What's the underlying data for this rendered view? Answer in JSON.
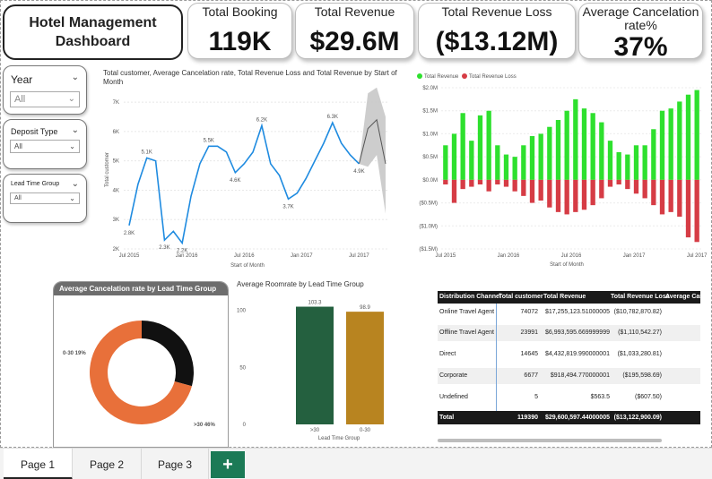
{
  "title": {
    "line1": "Hotel Management",
    "line2": "Dashboard"
  },
  "kpis": [
    {
      "label": "Total Booking",
      "value": "119K"
    },
    {
      "label": "Total Revenue",
      "value": "$29.6M"
    },
    {
      "label": "Total Revenue Loss",
      "value": "($13.12M)"
    },
    {
      "label": "Average Cancelation rate%",
      "value": "37%"
    }
  ],
  "slicers": {
    "year": {
      "title": "Year",
      "value": "All"
    },
    "deposit": {
      "title": "Deposit Type",
      "value": "All"
    },
    "lead": {
      "title": "Lead Time Group",
      "value": "All"
    }
  },
  "tabs": {
    "page1": "Page 1",
    "page2": "Page 2",
    "page3": "Page 3",
    "add": "+"
  },
  "colors": {
    "line": "#1f8be0",
    "revenue": "#2ee02e",
    "loss": "#d63c45",
    "donut_black": "#111111",
    "donut_orange": "#e8703a",
    "bar_green": "#24603f",
    "bar_gold": "#b88420",
    "add_tab": "#1b7a56"
  },
  "chart_data": [
    {
      "type": "line",
      "title": "Total customer, Average Cancelation rate, Total Revenue Loss and Total Revenue by Start of Month",
      "xlabel": "Start of Month",
      "ylabel": "Total customer",
      "x_ticks": [
        "Jul 2015",
        "Jan 2016",
        "Jul 2016",
        "Jan 2017",
        "Jul 2017"
      ],
      "y_ticks": [
        "2K",
        "3K",
        "4K",
        "5K",
        "6K",
        "7K"
      ],
      "ylim": [
        2000,
        7400
      ],
      "values": [
        2800,
        4200,
        5100,
        5000,
        2300,
        2600,
        2200,
        3800,
        4900,
        5500,
        5500,
        5300,
        4600,
        4900,
        5300,
        6200,
        4900,
        4500,
        3700,
        3900,
        4400,
        5000,
        5600,
        6300,
        5600,
        5200,
        4900
      ],
      "data_labels": [
        {
          "index": 0,
          "text": "2.8K"
        },
        {
          "index": 2,
          "text": "5.1K"
        },
        {
          "index": 4,
          "text": "2.3K"
        },
        {
          "index": 6,
          "text": "2.2K"
        },
        {
          "index": 9,
          "text": "5.5K"
        },
        {
          "index": 12,
          "text": "4.6K"
        },
        {
          "index": 15,
          "text": "6.2K"
        },
        {
          "index": 18,
          "text": "3.7K"
        },
        {
          "index": 23,
          "text": "6.3K"
        },
        {
          "index": 26,
          "text": "4.9K"
        }
      ],
      "forecast": {
        "values": [
          4900,
          6100,
          6400,
          4900
        ],
        "upper": [
          4900,
          7300,
          7500,
          6500
        ],
        "lower": [
          4900,
          4800,
          5200,
          3200
        ]
      }
    },
    {
      "type": "bar",
      "series": [
        {
          "name": "Total Revenue",
          "values": [
            0.75,
            1.0,
            1.45,
            0.85,
            1.4,
            1.5,
            0.75,
            0.55,
            0.5,
            0.75,
            0.95,
            1.0,
            1.15,
            1.3,
            1.5,
            1.75,
            1.55,
            1.45,
            1.25,
            0.85,
            0.6,
            0.55,
            0.75,
            0.75,
            1.1,
            1.5,
            1.55,
            1.7,
            1.85,
            1.95
          ]
        },
        {
          "name": "Total Revenue Loss",
          "values": [
            -0.1,
            -0.5,
            -0.2,
            -0.15,
            -0.1,
            -0.25,
            -0.1,
            -0.15,
            -0.25,
            -0.35,
            -0.5,
            -0.45,
            -0.6,
            -0.7,
            -0.75,
            -0.7,
            -0.65,
            -0.55,
            -0.4,
            -0.15,
            -0.1,
            -0.2,
            -0.3,
            -0.4,
            -0.55,
            -0.75,
            -0.7,
            -0.8,
            -1.25,
            -1.35
          ]
        }
      ],
      "xlabel": "Start of Month",
      "x_ticks": [
        "Jul 2015",
        "Jan 2016",
        "Jul 2016",
        "Jan 2017",
        "Jul 2017"
      ],
      "y_ticks": [
        "$2.0M",
        "$1.5M",
        "$1.0M",
        "$0.5M",
        "$0.0M",
        "($0.5M)",
        "($1.0M)",
        "($1.5M)"
      ],
      "ylim": [
        -1.5,
        2.0
      ]
    },
    {
      "type": "pie",
      "title": "Average Cancelation rate by Lead Time Group",
      "slices": [
        {
          "label": "0-30 19%",
          "value": 19
        },
        {
          "label": ">30 46%",
          "value": 46
        }
      ]
    },
    {
      "type": "bar",
      "title": "Average Roomrate by Lead Time Group",
      "xlabel": "Lead Time Group",
      "categories": [
        ">30",
        "0-30"
      ],
      "values": [
        103.3,
        98.9
      ],
      "data_labels": [
        "103.3",
        "98.9"
      ],
      "y_ticks": [
        "0",
        "50",
        "100"
      ],
      "ylim": [
        0,
        110
      ]
    },
    {
      "type": "table",
      "columns": [
        "Distribution Channel",
        "Total customer",
        "Total Revenue",
        "Total Revenue Loss",
        "Average Canc"
      ],
      "rows": [
        [
          "Online Travel Agent",
          "74072",
          "$17,255,123.51000005",
          "($10,782,870.82)"
        ],
        [
          "Offline Travel Agent",
          "23991",
          "$6,993,595.669999999",
          "($1,110,542.27)"
        ],
        [
          "Direct",
          "14645",
          "$4,432,819.990000001",
          "($1,033,280.81)"
        ],
        [
          "Corporate",
          "6677",
          "$918,494.770000001",
          "($195,598.69)"
        ],
        [
          "Undefined",
          "5",
          "$563.5",
          "($607.50)"
        ]
      ],
      "total": [
        "Total",
        "119390",
        "$29,600,597.44000005",
        "($13,122,900.09)"
      ]
    }
  ]
}
